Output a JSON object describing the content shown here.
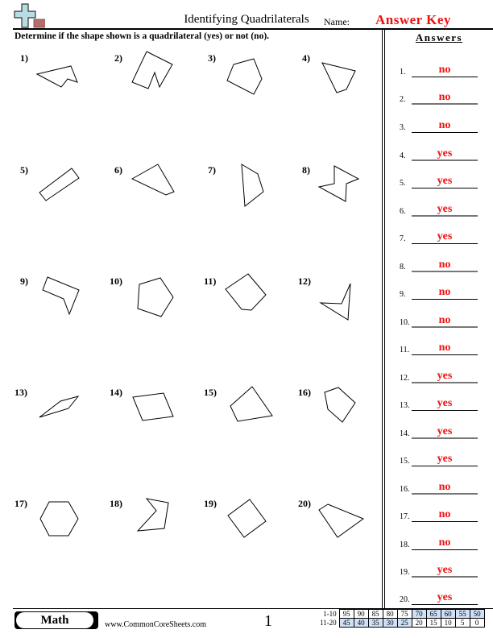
{
  "header": {
    "title": "Identifying Quadrilaterals",
    "name_label": "Name:",
    "name_value": "Answer Key",
    "instructions": "Determine if the shape shown is a quadrilateral (yes) or not (no).",
    "logo_icon": "plus-minus-math-icon"
  },
  "colors": {
    "answer_red": "#ee1111",
    "logo_plus": "#b8dce4",
    "logo_minus": "#b86b6b",
    "score_highlight": "#cfe0f7"
  },
  "answers_panel": {
    "heading": "Answers",
    "items": [
      {
        "num": "1.",
        "answer": "no"
      },
      {
        "num": "2.",
        "answer": "no"
      },
      {
        "num": "3.",
        "answer": "no"
      },
      {
        "num": "4.",
        "answer": "yes"
      },
      {
        "num": "5.",
        "answer": "yes"
      },
      {
        "num": "6.",
        "answer": "yes"
      },
      {
        "num": "7.",
        "answer": "yes"
      },
      {
        "num": "8.",
        "answer": "no"
      },
      {
        "num": "9.",
        "answer": "no"
      },
      {
        "num": "10.",
        "answer": "no"
      },
      {
        "num": "11.",
        "answer": "no"
      },
      {
        "num": "12.",
        "answer": "yes"
      },
      {
        "num": "13.",
        "answer": "yes"
      },
      {
        "num": "14.",
        "answer": "yes"
      },
      {
        "num": "15.",
        "answer": "yes"
      },
      {
        "num": "16.",
        "answer": "no"
      },
      {
        "num": "17.",
        "answer": "no"
      },
      {
        "num": "18.",
        "answer": "no"
      },
      {
        "num": "19.",
        "answer": "yes"
      },
      {
        "num": "20.",
        "answer": "yes"
      }
    ]
  },
  "problems": [
    {
      "label": "1)",
      "shape": "concave pentagon (arrow notch)",
      "sides": 5
    },
    {
      "label": "2)",
      "shape": "concave hexagon (notched)",
      "sides": 6
    },
    {
      "label": "3)",
      "shape": "pentagon",
      "sides": 5
    },
    {
      "label": "4)",
      "shape": "quadrilateral",
      "sides": 4
    },
    {
      "label": "5)",
      "shape": "rectangle",
      "sides": 4
    },
    {
      "label": "6)",
      "shape": "quadrilateral",
      "sides": 4
    },
    {
      "label": "7)",
      "shape": "quadrilateral",
      "sides": 4
    },
    {
      "label": "8)",
      "shape": "concave hexagon (bowtie)",
      "sides": 6
    },
    {
      "label": "9)",
      "shape": "concave pentagon",
      "sides": 5
    },
    {
      "label": "10)",
      "shape": "pentagon",
      "sides": 5
    },
    {
      "label": "11)",
      "shape": "pentagon",
      "sides": 5
    },
    {
      "label": "12)",
      "shape": "concave quadrilateral (dart)",
      "sides": 4
    },
    {
      "label": "13)",
      "shape": "quadrilateral (thin parallelogram)",
      "sides": 4
    },
    {
      "label": "14)",
      "shape": "quadrilateral",
      "sides": 4
    },
    {
      "label": "15)",
      "shape": "quadrilateral",
      "sides": 4
    },
    {
      "label": "16)",
      "shape": "pentagon",
      "sides": 5
    },
    {
      "label": "17)",
      "shape": "hexagon",
      "sides": 6
    },
    {
      "label": "18)",
      "shape": "concave pentagon",
      "sides": 5
    },
    {
      "label": "19)",
      "shape": "square",
      "sides": 4
    },
    {
      "label": "20)",
      "shape": "quadrilateral",
      "sides": 4
    }
  ],
  "footer": {
    "subject": "Math",
    "website": "www.CommonCoreSheets.com",
    "page_number": "1",
    "score_rows": [
      {
        "label": "1-10",
        "scores": [
          "95",
          "90",
          "85",
          "80",
          "75",
          "70",
          "65",
          "60",
          "55",
          "50"
        ]
      },
      {
        "label": "11-20",
        "scores": [
          "45",
          "40",
          "35",
          "30",
          "25",
          "20",
          "15",
          "10",
          "5",
          "0"
        ]
      }
    ]
  }
}
